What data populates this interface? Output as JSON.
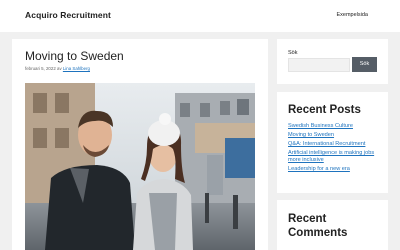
{
  "header": {
    "site_title": "Acquiro Recruitment",
    "nav": [
      "Exempelsida"
    ]
  },
  "post": {
    "title": "Moving to Sweden",
    "date": "februari 5, 2022",
    "by": "av",
    "author": "Lina Sahlberg",
    "image_alt": "Couple walking on a city street"
  },
  "sidebar": {
    "search": {
      "label": "Sök",
      "placeholder": "",
      "button_label": "Sök"
    },
    "recent_posts": {
      "title": "Recent Posts",
      "items": [
        "Swedish Business Culture",
        "Moving to Sweden",
        "Q&A: International Recruitment",
        "Artificial intelligence is making jobs more inclusive",
        "Leadership for a new era"
      ]
    },
    "recent_comments": {
      "title": "Recent Comments"
    }
  },
  "colors": {
    "background": "#f0f0f0",
    "link": "#1e73be",
    "button": "#555d66"
  }
}
